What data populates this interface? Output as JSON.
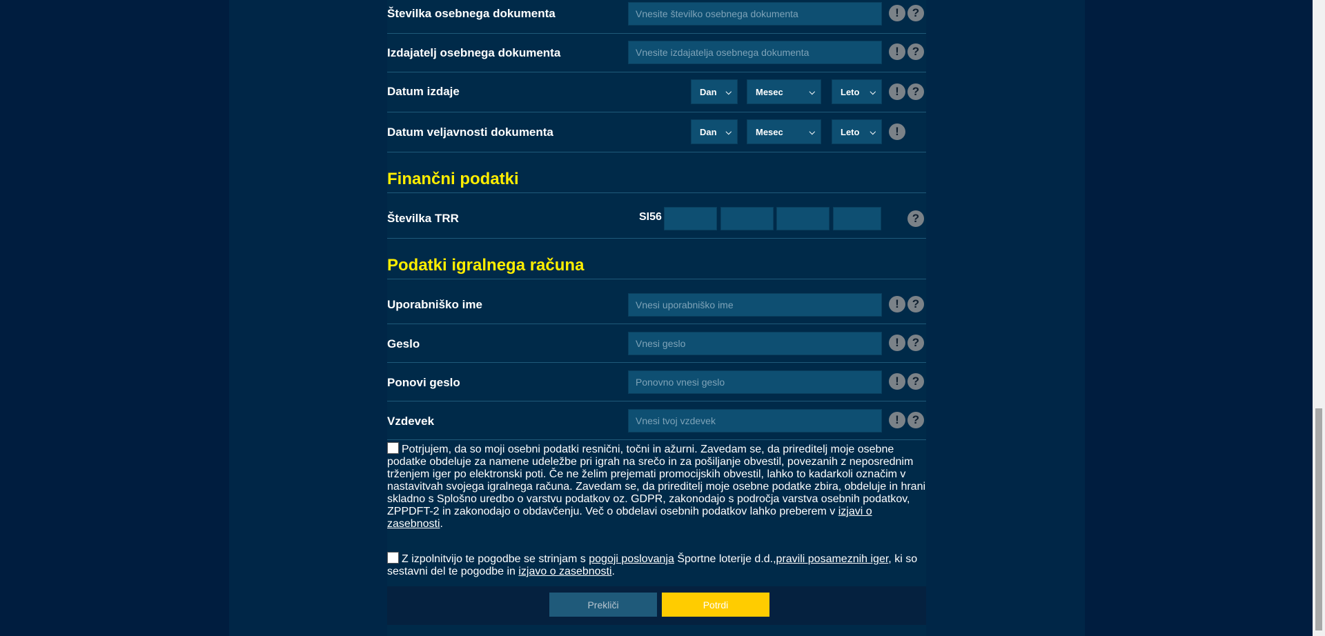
{
  "identity": {
    "doc_number": {
      "label": "Številka osebnega dokumenta",
      "placeholder": "Vnesite številko osebnega dokumenta"
    },
    "doc_issuer": {
      "label": "Izdajatelj osebnega dokumenta",
      "placeholder": "Vnesite izdajatelja osebnega dokumenta"
    },
    "issue_date": {
      "label": "Datum izdaje",
      "day": "Dan",
      "month": "Mesec",
      "year": "Leto"
    },
    "valid_date": {
      "label": "Datum veljavnosti dokumenta",
      "day": "Dan",
      "month": "Mesec",
      "year": "Leto"
    }
  },
  "financial": {
    "title": "Finančni podatki",
    "trr_label": "Številka TRR",
    "trr_prefix": "SI56"
  },
  "account": {
    "title": "Podatki igralnega računa",
    "username": {
      "label": "Uporabniško ime",
      "placeholder": "Vnesi uporabniško ime"
    },
    "password": {
      "label": "Geslo",
      "placeholder": "Vnesi geslo"
    },
    "password_repeat": {
      "label": "Ponovi geslo",
      "placeholder": "Ponovno vnesi geslo"
    },
    "nickname": {
      "label": "Vzdevek",
      "placeholder": "Vnesi tvoj vzdevek"
    }
  },
  "icons": {
    "warning": "!",
    "help": "?"
  },
  "consent1": {
    "text": "Potrjujem, da so moji osebni podatki resnični, točni in ažurni. Zavedam se, da prireditelj moje osebne podatke obdeluje za namene udeležbe pri igrah na srečo in za pošiljanje obvestil, povezanih z neposrednim trženjem iger po elektronski poti. Če ne želim prejemati promocijskih obvestil, lahko to kadarkoli označim v nastavitvah svojega igralnega računa. Zavedam se, da prireditelj moje osebne podatke zbira, obdeluje in hrani skladno s Splošno uredbo o varstvu podatkov oz. GDPR, zakonodajo s področja varstva osebnih podatkov, ZPPDFT-2 in zakonodajo o obdavčenju. Več o obdelavi osebnih podatkov lahko preberem v ",
    "link": "izjavi o zasebnosti",
    "end": "."
  },
  "consent2": {
    "text1": "Z izpolnitvijo te pogodbe se strinjam s ",
    "link1": "pogoji poslovanja",
    "text2": " Športne loterije d.d.,",
    "link2": "pravili posameznih iger",
    "text3": ", ki so sestavni del te pogodbe in ",
    "link3": "izjavo o zasebnosti",
    "text4": "."
  },
  "buttons": {
    "cancel": "Prekliči",
    "confirm": "Potrdi"
  },
  "colors": {
    "accent": "#ffee00",
    "confirm": "#ffcc00",
    "field": "#0e4f72",
    "background": "#001d3f"
  }
}
